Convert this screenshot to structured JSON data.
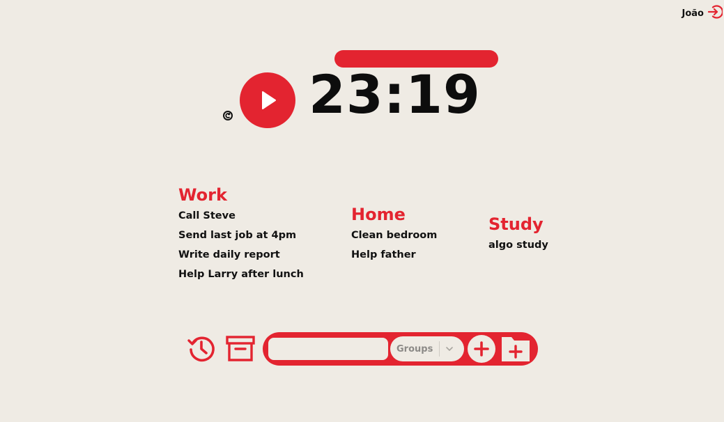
{
  "user": {
    "name": "João",
    "icon": "logout-icon"
  },
  "timer": {
    "display": "23:19",
    "progress": 1.0
  },
  "controls": {
    "reset_icon": "reset-icon",
    "play_icon": "play-icon"
  },
  "groups": [
    {
      "title": "Work",
      "tasks": [
        "Call Steve",
        "Send last job at 4pm",
        "Write daily report",
        "Help Larry after lunch"
      ]
    },
    {
      "title": "Home",
      "tasks": [
        "Clean bedroom",
        "Help father"
      ]
    },
    {
      "title": "Study",
      "tasks": [
        "algo study"
      ]
    }
  ],
  "toolbar": {
    "history_icon": "history-icon",
    "archive_icon": "archive-icon",
    "task_input_value": "",
    "groups_placeholder": "Groups",
    "add_task_icon": "plus-icon",
    "add_group_icon": "folder-plus-icon"
  },
  "colors": {
    "accent": "#e32430",
    "background": "#efebe4",
    "text": "#111111"
  }
}
